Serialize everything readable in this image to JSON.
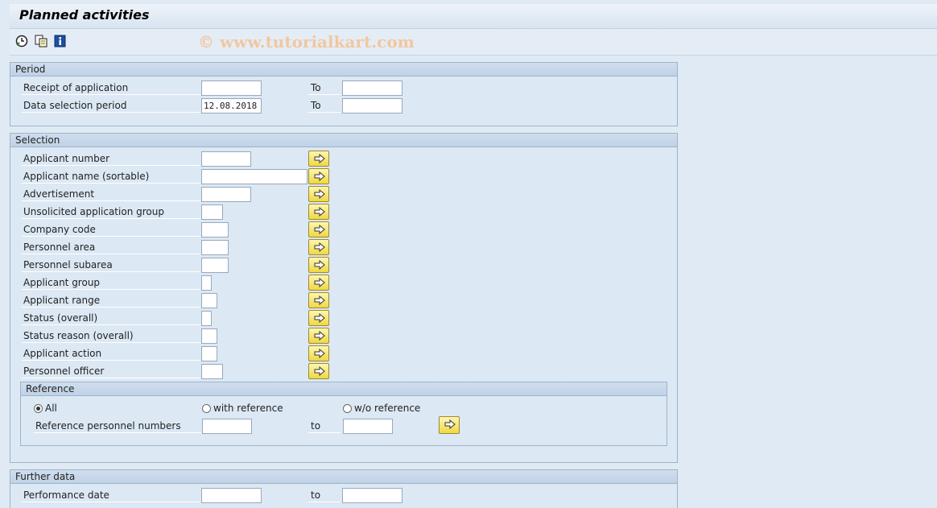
{
  "title": "Planned activities",
  "watermark": "© www.tutorialkart.com",
  "toolbar": {
    "icons": [
      "execute-clock-icon",
      "copy-variant-icon",
      "info-icon"
    ]
  },
  "period": {
    "header": "Period",
    "receipt_label": "Receipt of application",
    "receipt_from": "",
    "receipt_to_label": "To",
    "receipt_to": "",
    "selection_label": "Data selection period",
    "selection_from": "12.08.2018",
    "selection_to_label": "To",
    "selection_to": ""
  },
  "selection": {
    "header": "Selection",
    "rows": [
      {
        "label": "Applicant number",
        "value": ""
      },
      {
        "label": "Applicant name (sortable)",
        "value": ""
      },
      {
        "label": "Advertisement",
        "value": ""
      },
      {
        "label": "Unsolicited application group",
        "value": ""
      },
      {
        "label": "Company code",
        "value": ""
      },
      {
        "label": "Personnel area",
        "value": ""
      },
      {
        "label": "Personnel subarea",
        "value": ""
      },
      {
        "label": "Applicant group",
        "value": ""
      },
      {
        "label": "Applicant range",
        "value": ""
      },
      {
        "label": "Status (overall)",
        "value": ""
      },
      {
        "label": "Status reason (overall)",
        "value": ""
      },
      {
        "label": "Applicant action",
        "value": ""
      },
      {
        "label": "Personnel officer",
        "value": ""
      }
    ]
  },
  "reference": {
    "header": "Reference",
    "radio_all": "All",
    "radio_with": "with reference",
    "radio_without": "w/o reference",
    "selected": "All",
    "numbers_label": "Reference personnel numbers",
    "numbers_from": "",
    "to_label": "to",
    "numbers_to": ""
  },
  "further": {
    "header": "Further data",
    "perf_label": "Performance date",
    "perf_from": "",
    "to_label": "to",
    "perf_to": ""
  },
  "colors": {
    "background": "#dfeaf5",
    "button_yellow": "#f0d840",
    "watermark": "#f2c7a0"
  }
}
